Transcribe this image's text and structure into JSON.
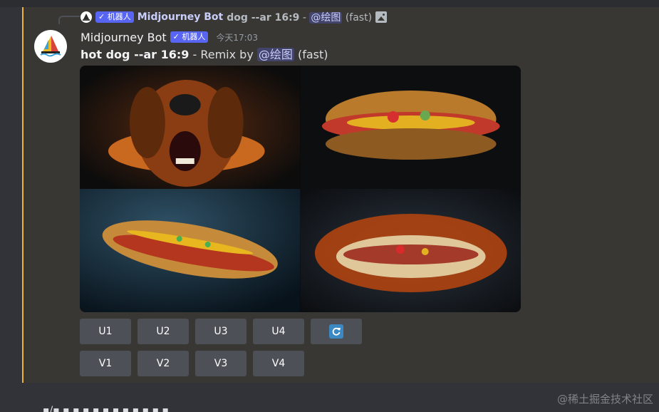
{
  "reply": {
    "author": "Midjourney Bot",
    "badge": "✓ 机器人",
    "prompt": "dog --ar 16:9",
    "separator": " - ",
    "mention": "@绘图",
    "speed": "(fast)"
  },
  "message": {
    "author": "Midjourney Bot",
    "badge": "✓ 机器人",
    "timestamp": "今天17:03",
    "prompt": "hot dog --ar 16:9",
    "remix_text": " - Remix by ",
    "mention": "@绘图",
    "speed": " (fast)"
  },
  "buttons": {
    "upscale": [
      "U1",
      "U2",
      "U3",
      "U4"
    ],
    "variation": [
      "V1",
      "V2",
      "V3",
      "V4"
    ],
    "reroll_icon": "refresh-icon"
  },
  "colors": {
    "accent_border": "#f0b232",
    "badge": "#5865f2",
    "button": "#4e5058",
    "background": "#393733"
  },
  "watermark": "@稀土掘金技术社区",
  "next_message_partial": "▪/▪ ▪ ▪ ▪ ▪  ▪ ▪ ▪ ▪ ▪ ▪ ▪"
}
